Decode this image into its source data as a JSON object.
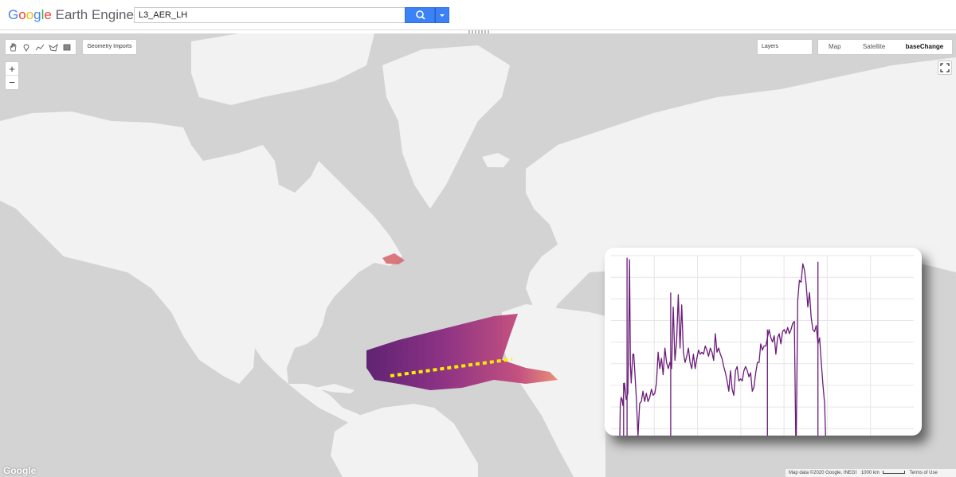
{
  "app": {
    "logo_letters": [
      "G",
      "o",
      "o",
      "g",
      "l",
      "e"
    ],
    "logo_rest": " Earth Engine"
  },
  "search": {
    "value": "L3_AER_LH"
  },
  "icons": {
    "search": "search-icon",
    "dropdown": "chevron-down-icon",
    "hand": "hand-icon",
    "marker": "marker-icon",
    "line": "line-icon",
    "polygon": "polygon-icon",
    "rectangle": "rectangle-icon",
    "fullscreen": "fullscreen-icon"
  },
  "map_controls": {
    "geometry_imports": "Geometry Imports",
    "zoom_in": "+",
    "zoom_out": "−",
    "layers": "Layers",
    "map_types": [
      "Map",
      "Satellite",
      "baseChange"
    ]
  },
  "footer": {
    "google_logo": "Google",
    "attribution": "Map data ©2020 Google, INEGI",
    "scale": "1000 km",
    "terms": "Terms of Use"
  },
  "colors": {
    "accent": "#3b82f6",
    "line": "#6a1b7a",
    "transect": "#ffee00"
  },
  "chart_data": {
    "type": "line",
    "x": [
      0,
      2,
      4,
      6,
      8,
      10,
      11,
      12,
      13,
      14,
      15,
      16,
      18,
      20,
      21,
      22,
      23,
      24,
      25,
      26,
      27,
      28,
      30,
      32,
      34,
      36,
      38,
      40,
      42,
      44,
      46,
      48,
      50,
      52,
      54,
      56,
      58,
      60,
      62,
      64,
      66,
      68,
      70,
      72,
      74,
      76,
      78,
      80,
      82,
      84,
      86,
      88,
      90,
      92,
      94,
      96,
      98,
      100,
      102,
      104,
      106,
      108,
      110,
      112,
      114,
      116,
      118,
      120,
      122,
      124,
      126,
      128,
      130,
      132,
      134,
      136,
      138,
      140,
      142,
      144,
      146,
      148,
      150,
      152,
      154,
      156,
      158,
      160,
      162,
      164,
      166,
      168,
      170,
      172,
      174,
      176,
      178,
      180,
      182,
      184,
      186,
      188,
      190,
      192,
      194,
      196,
      198,
      200,
      202,
      204,
      206,
      208,
      210,
      212,
      214,
      216,
      218,
      220,
      222,
      224,
      226,
      228,
      230,
      232,
      234,
      236,
      238,
      240,
      242,
      244,
      246,
      248,
      250,
      252,
      254,
      256,
      258,
      260,
      262,
      264,
      266,
      267,
      268,
      269,
      270,
      272,
      274,
      276,
      278,
      280,
      282,
      284,
      286,
      288,
      290,
      292,
      294,
      296,
      298,
      300,
      302,
      304,
      306
    ],
    "values": [
      0,
      0,
      0,
      0,
      0,
      0,
      28,
      31,
      30,
      27,
      32,
      38,
      30,
      33,
      60,
      98,
      47,
      38,
      46,
      52,
      52,
      45,
      31,
      12,
      28,
      29,
      34,
      29,
      33,
      29,
      31,
      35,
      32,
      33,
      38,
      53,
      45,
      50,
      42,
      55,
      48,
      45,
      48,
      45,
      75,
      49,
      58,
      81,
      55,
      76,
      53,
      48,
      51,
      55,
      48,
      45,
      52,
      45,
      50,
      54,
      52,
      53,
      52,
      56,
      54,
      51,
      55,
      53,
      49,
      62,
      53,
      55,
      52,
      50,
      46,
      43,
      39,
      34,
      44,
      35,
      32,
      44,
      46,
      39,
      40,
      39,
      44,
      46,
      44,
      41,
      43,
      34,
      36,
      43,
      48,
      48,
      57,
      54,
      56,
      56,
      60,
      64,
      60,
      58,
      61,
      52,
      60,
      62,
      57,
      63,
      64,
      62,
      65,
      62,
      64,
      67,
      68,
      0,
      78,
      88,
      87,
      96,
      93,
      86,
      75,
      82,
      70,
      64,
      63,
      66,
      57,
      60,
      48,
      37,
      28,
      0,
      0,
      0,
      0,
      0,
      0,
      0,
      0,
      0,
      0,
      0,
      0,
      0,
      0,
      0,
      0,
      0,
      0,
      0,
      0,
      0,
      0,
      0,
      0,
      0,
      0,
      0,
      0
    ],
    "peaks": [
      {
        "x": 15,
        "value": 38
      },
      {
        "x": 19,
        "value": 99
      },
      {
        "x": 71,
        "value": 82
      },
      {
        "x": 186,
        "value": 64
      },
      {
        "x": 246,
        "value": 97
      }
    ],
    "xlim": [
      0,
      360
    ],
    "ylim": [
      0,
      100
    ],
    "grid": true,
    "title": "",
    "xlabel": "",
    "ylabel": ""
  }
}
